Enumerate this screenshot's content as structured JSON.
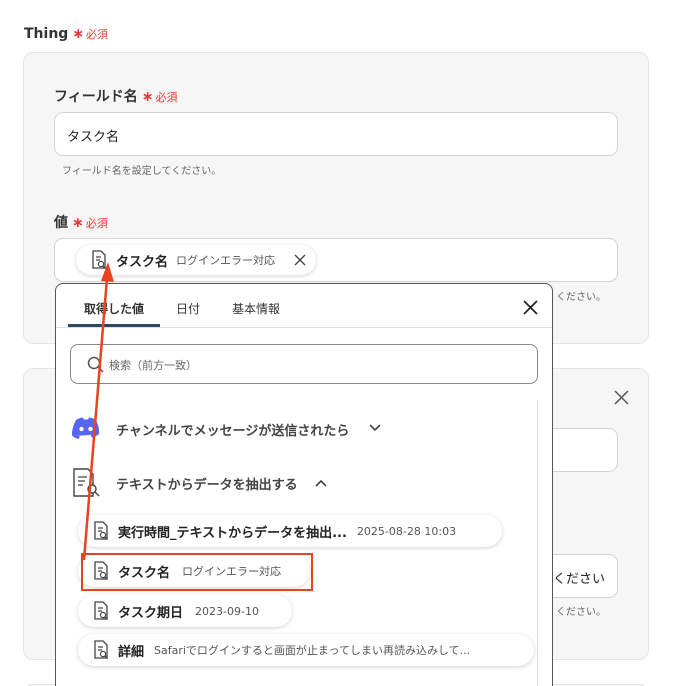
{
  "thing": {
    "label": "Thing",
    "required": "必須"
  },
  "field_name": {
    "label": "フィールド名",
    "required": "必須",
    "value": "タスク名",
    "helper": "フィールド名を設定してください。"
  },
  "value_field": {
    "label": "値",
    "required": "必須",
    "chip": {
      "name": "タスク名",
      "value": "ログインエラー対応"
    },
    "helper_tail": "ください。"
  },
  "second_card": {
    "input_tail": "ください",
    "helper_tail": "ください。"
  },
  "picker": {
    "tabs": [
      "取得した値",
      "日付",
      "基本情報"
    ],
    "search_placeholder": "検索（前方一致）",
    "groups": [
      {
        "title": "チャンネルでメッセージが送信されたら",
        "expanded": false,
        "icon": "discord-icon"
      },
      {
        "title": "テキストからデータを抽出する",
        "expanded": true,
        "icon": "document-search-icon"
      }
    ],
    "items": [
      {
        "name": "実行時間_テキストからデータを抽出...",
        "value": "2025-08-28 10:03"
      },
      {
        "name": "タスク名",
        "value": "ログインエラー対応"
      },
      {
        "name": "タスク期日",
        "value": "2023-09-10"
      },
      {
        "name": "詳細",
        "value": "Safariでログインすると画面が止まってしまい再読み込みして..."
      }
    ]
  },
  "colors": {
    "required": "#e53935",
    "highlight": "#e8431f",
    "tab_active": "#2b4a5e",
    "discord": "#5865F2"
  }
}
